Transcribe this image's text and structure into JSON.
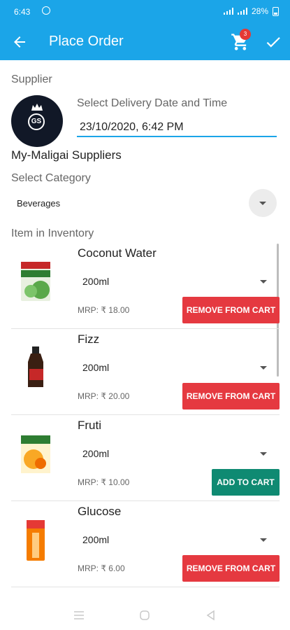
{
  "status_bar": {
    "time": "6:43",
    "battery": "28%"
  },
  "app_bar": {
    "title": "Place Order",
    "cart_count": "3"
  },
  "form": {
    "supplier_label": "Supplier",
    "delivery_label": "Select Delivery Date and Time",
    "delivery_value": "23/10/2020, 6:42 PM",
    "supplier_name": "My-Maligai Suppliers",
    "supplier_logo_text": "GS",
    "category_label": "Select Category",
    "category_value": "Beverages",
    "inventory_label": "Item in Inventory"
  },
  "items": [
    {
      "name": "Coconut Water",
      "size": "200ml",
      "mrp": "MRP: ₹ 18.00",
      "action": "REMOVE FROM CART",
      "action_type": "remove"
    },
    {
      "name": "Fizz",
      "size": "200ml",
      "mrp": "MRP: ₹ 20.00",
      "action": "REMOVE FROM CART",
      "action_type": "remove"
    },
    {
      "name": "Fruti",
      "size": "200ml",
      "mrp": "MRP: ₹ 10.00",
      "action": "ADD TO CART",
      "action_type": "add"
    },
    {
      "name": "Glucose",
      "size": "200ml",
      "mrp": "MRP: ₹ 6.00",
      "action": "REMOVE FROM CART",
      "action_type": "remove"
    }
  ],
  "colors": {
    "primary": "#1ba5e8",
    "remove": "#e53940",
    "add": "#0f8a72",
    "badge": "#e53935"
  },
  "icons": [
    "back-arrow-icon",
    "cart-icon",
    "check-icon",
    "chevron-down-icon",
    "menu-icon",
    "home-icon",
    "back-icon"
  ]
}
